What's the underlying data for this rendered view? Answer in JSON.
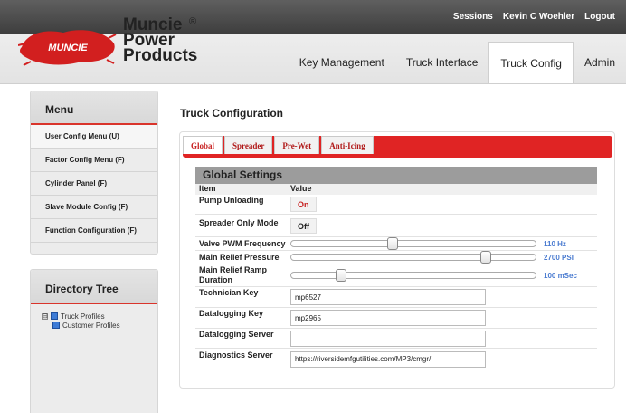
{
  "header": {
    "brand_line1": "Muncie",
    "brand_line2": "Power",
    "brand_line3": "Products",
    "brand_reg": "®",
    "logo_splash_text": "MUNCIE",
    "top_links": [
      "Sessions",
      "Kevin C Woehler",
      "Logout"
    ],
    "nav_tabs": [
      {
        "label": "Key Management"
      },
      {
        "label": "Truck Interface"
      },
      {
        "label": "Truck Config",
        "active": true
      },
      {
        "label": "Admin"
      }
    ]
  },
  "menu": {
    "title": "Menu",
    "items": [
      "User Config Menu (U)",
      "Factor Config Menu (F)",
      "Cylinder Panel (F)",
      "Slave Module Config (F)",
      "Function Configuration (F)"
    ]
  },
  "directory": {
    "title": "Directory Tree",
    "expander": "⊟",
    "root": "Truck Profiles",
    "child": "Customer Profiles"
  },
  "main": {
    "page_title": "Truck Configuration",
    "tabs": [
      "Global",
      "Spreader",
      "Pre-Wet",
      "Anti-Icing"
    ],
    "active_tab": "Global",
    "section_title": "Global Settings",
    "col_item": "Item",
    "col_value": "Value",
    "pump_unloading": {
      "label": "Pump Unloading",
      "value": "On"
    },
    "spreader_only": {
      "label": "Spreader Only Mode",
      "value": "Off"
    },
    "valve_pwm": {
      "label": "Valve PWM Frequency",
      "display": "110 Hz",
      "level": 0.41
    },
    "main_relief_pressure": {
      "label": "Main Relief Pressure",
      "display": "2700 PSI",
      "level": 0.81
    },
    "ramp_duration": {
      "label": "Main Relief Ramp Duration",
      "display": "100 mSec",
      "level": 0.19
    },
    "technician_key": {
      "label": "Technician Key",
      "value": "mp6527"
    },
    "datalogging_key": {
      "label": "Datalogging Key",
      "value": "mp2965"
    },
    "datalogging_server": {
      "label": "Datalogging Server",
      "value": ""
    },
    "diagnostics_server": {
      "label": "Diagnostics Server",
      "value": "https://riversidemfgutilities.com/MP3/cmgr/"
    }
  },
  "colors": {
    "accent_red": "#e02424",
    "link_blue": "#4a7bd0"
  }
}
